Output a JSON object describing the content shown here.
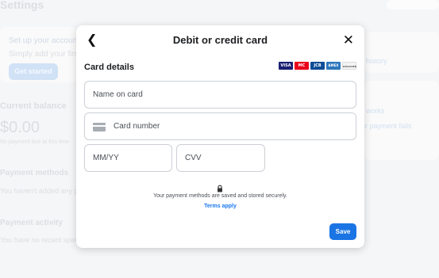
{
  "background": {
    "page_title": "Settings",
    "setup_title": "Set up your account",
    "setup_sub": "Simply add your first payment method",
    "get_started": "Get started",
    "current_balance": "Current balance",
    "balance": "$0.00",
    "balance_sub": "No payment due at this time",
    "payment_methods": "Payment methods",
    "payment_methods_sub": "You haven't added any payment methods",
    "payment_activity": "Payment activity",
    "payment_activity_sub": "You have no recent spending",
    "link_history": "history",
    "link_works": "works",
    "link_fails": "ur payment fails"
  },
  "modal": {
    "title": "Debit or credit card",
    "card_details_label": "Card details",
    "brands": [
      {
        "name": "VISA",
        "color": "#1a1f71"
      },
      {
        "name": "MC",
        "color": "#eb001b"
      },
      {
        "name": "JCB",
        "color": "#0e4c96"
      },
      {
        "name": "AMEX",
        "color": "#2e77bc"
      },
      {
        "name": "DISCOVER",
        "color": "#f4f4f4"
      }
    ],
    "name_placeholder": "Name on card",
    "card_placeholder": "Card number",
    "expiry_placeholder": "MM/YY",
    "cvv_placeholder": "CVV",
    "security_note": "Your payment methods are saved and stored securely.",
    "terms_link": "Terms apply",
    "save_label": "Save"
  }
}
